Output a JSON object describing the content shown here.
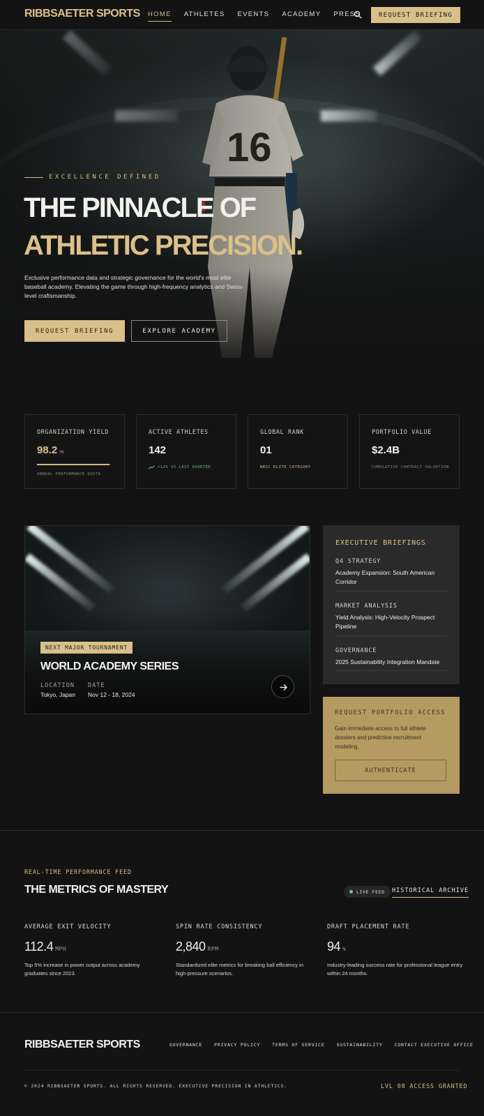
{
  "brand": "RIBBSAETER SPORTS",
  "nav": {
    "links": [
      "HOME",
      "ATHLETES",
      "EVENTS",
      "ACADEMY",
      "PRESS"
    ],
    "active_index": 0,
    "search_icon": "search-icon",
    "cta": "REQUEST BRIEFING"
  },
  "hero": {
    "eyebrow": "EXCELLENCE DEFINED",
    "title_line1": "THE PINNACLE OF",
    "title_line2": "ATHLETIC PRECISION.",
    "description": "Exclusive performance data and strategic governance for the world's most elite baseball academy. Elevating the game through high-frequency analytics and Swiss-level craftsmanship.",
    "primary_button": "REQUEST BRIEFING",
    "secondary_button": "EXPLORE ACADEMY",
    "jersey_number": "16"
  },
  "stats": [
    {
      "label": "ORGANIZATION YIELD",
      "value": "98.2",
      "unit": "%",
      "note": "ANNUAL PERFORMANCE QUOTA",
      "progress": 0.982
    },
    {
      "label": "ACTIVE ATHLETES",
      "value": "142",
      "note": "+12% VS LAST QUARTER",
      "icon": "trend-up-icon"
    },
    {
      "label": "GLOBAL RANK",
      "value": "01",
      "note": "WBSC ELITE CATEGORY"
    },
    {
      "label": "PORTFOLIO VALUE",
      "value": "$2.4B",
      "note": "CUMULATIVE CONTRACT VALUATION"
    }
  ],
  "tournament": {
    "badge": "NEXT MAJOR TOURNAMENT",
    "title": "WORLD ACADEMY SERIES",
    "location_label": "LOCATION",
    "location": "Tokyo, Japan",
    "date_label": "DATE",
    "date": "Nov 12 - 18, 2024",
    "arrow_icon": "arrow-right-icon"
  },
  "briefings": {
    "title": "EXECUTIVE BRIEFINGS",
    "items": [
      {
        "category": "Q4 STRATEGY",
        "text": "Academy Expansion: South American Corridor"
      },
      {
        "category": "MARKET ANALYSIS",
        "text": "Yield Analysis: High-Velocity Prospect Pipeline"
      },
      {
        "category": "GOVERNANCE",
        "text": "2025 Sustainability Integration Mandate"
      }
    ]
  },
  "portfolio": {
    "title": "REQUEST PORTFOLIO ACCESS",
    "text": "Gain immediate access to full athlete dossiers and predictive recruitment modeling.",
    "button": "AUTHENTICATE"
  },
  "metrics": {
    "eyebrow": "REAL-TIME PERFORMANCE FEED",
    "title": "THE METRICS OF MASTERY",
    "live_label": "LIVE FEED",
    "archive_link": "HISTORICAL ARCHIVE",
    "items": [
      {
        "label": "AVERAGE EXIT VELOCITY",
        "value": "112.4",
        "unit": "MPH",
        "text": "Top 5% increase in power output across academy graduates since 2023."
      },
      {
        "label": "SPIN RATE CONSISTENCY",
        "value": "2,840",
        "unit": "RPM",
        "text": "Standardized elite metrics for breaking ball efficiency in high-pressure scenarios."
      },
      {
        "label": "DRAFT PLACEMENT RATE",
        "value": "94",
        "unit": "%",
        "text": "Industry-leading success rate for professional league entry within 24 months."
      }
    ]
  },
  "footer": {
    "brand": "RIBBSAETER SPORTS",
    "links": [
      "GOVERNANCE",
      "PRIVACY POLICY",
      "TERMS OF SERVICE",
      "SUSTAINABILITY",
      "CONTACT EXECUTIVE OFFICE"
    ],
    "copyright": "© 2024 RIBBSAETER SPORTS. ALL RIGHTS RESERVED. EXECUTIVE PRECISION IN ATHLETICS.",
    "access": "LVL 08 ACCESS GRANTED"
  },
  "colors": {
    "accent_gold": "#d9bf8a",
    "background": "#131313",
    "panel": "#2a2a2a",
    "portfolio_panel": "#b59a62",
    "live_green": "#5fd08b"
  }
}
